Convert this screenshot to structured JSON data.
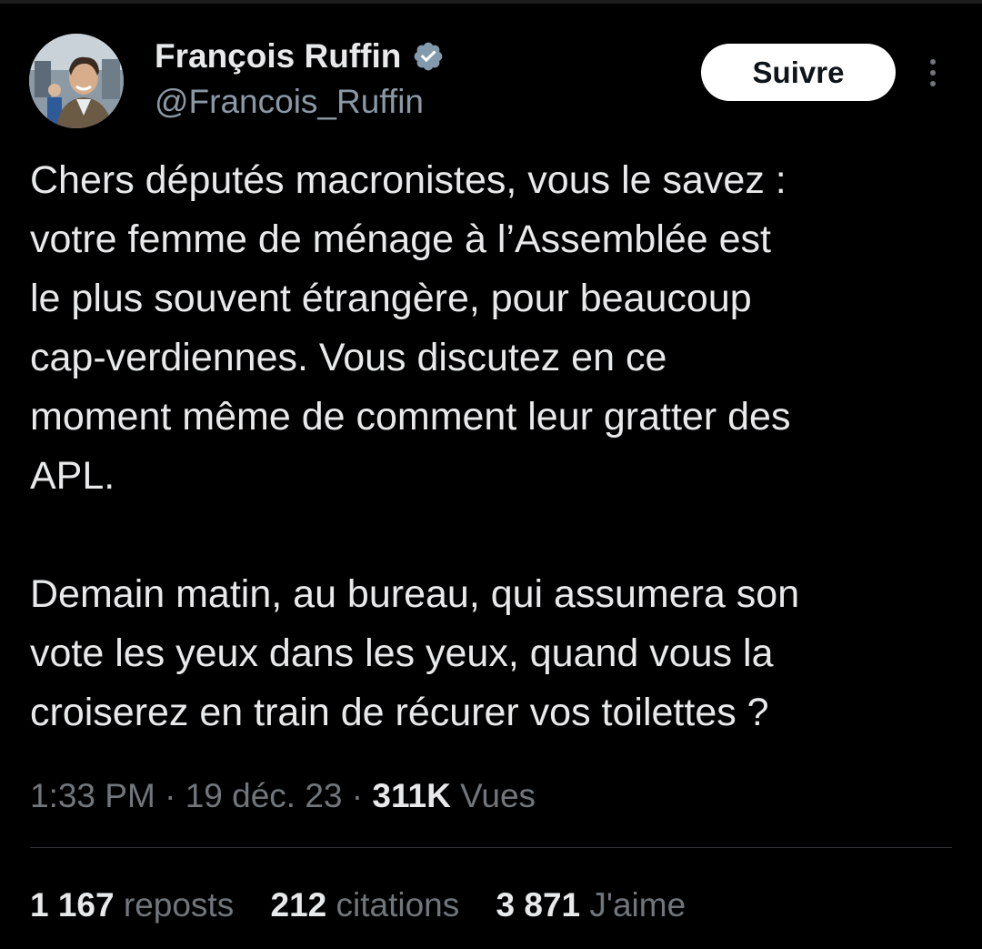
{
  "user": {
    "name": "François Ruffin",
    "handle": "@Francois_Ruffin",
    "verified": true
  },
  "actions": {
    "follow_label": "Suivre"
  },
  "tweet": {
    "paragraph_1": [
      "Chers députés macronistes, vous le savez :",
      "votre femme de ménage à l’Assemblée est",
      "le plus souvent étrangère, pour beaucoup",
      "cap-verdiennes. Vous discutez en ce",
      "moment même de comment leur gratter des",
      "APL."
    ],
    "paragraph_2": [
      "Demain matin, au bureau, qui assumera son",
      "vote les yeux dans les yeux, quand vous la",
      "croiserez en train de récurer vos toilettes ?"
    ]
  },
  "meta": {
    "time": "1:33 PM",
    "separator": "·",
    "date": "19 déc. 23",
    "views_count": "311K",
    "views_label": "Vues"
  },
  "stats": [
    {
      "count": "1 167",
      "label": "reposts"
    },
    {
      "count": "212",
      "label": "citations"
    },
    {
      "count": "3 871",
      "label": "J'aime"
    }
  ],
  "colors": {
    "background": "#000000",
    "text_primary": "#e7e9ea",
    "text_secondary": "#71767b",
    "verified_badge": "#829aab",
    "follow_button_bg": "#ffffff",
    "divider": "#2f3336"
  },
  "icons": {
    "verified": "verified-badge-icon",
    "more": "more-dots-vertical-icon"
  }
}
